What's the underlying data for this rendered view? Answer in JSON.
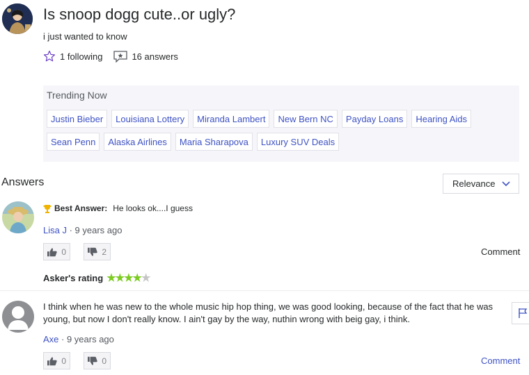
{
  "question": {
    "title": "Is snoop dogg cute..or ugly?",
    "details": "i just wanted to know",
    "following": "1 following",
    "answers_count": "16 answers"
  },
  "trending": {
    "title": "Trending Now",
    "items": [
      "Justin Bieber",
      "Louisiana Lottery",
      "Miranda Lambert",
      "New Bern NC",
      "Payday Loans",
      "Hearing Aids",
      "Sean Penn",
      "Alaska Airlines",
      "Maria Sharapova",
      "Luxury SUV Deals"
    ]
  },
  "answers_header": {
    "title": "Answers",
    "sort_label": "Relevance"
  },
  "answers": [
    {
      "best_label": "Best Answer:",
      "text": "He looks ok....I guess",
      "author": "Lisa J",
      "time": " · 9 years ago",
      "upvotes": "0",
      "downvotes": "2",
      "comment_label": "Comment",
      "rating_label": "Asker's rating",
      "rating_stars": "★★★★",
      "rating_empty": "★",
      "rating": 4,
      "rating_max": 5
    },
    {
      "text": "I think when he was new to the whole music hip hop thing, we was good looking, because of the fact that he was young, but now I don't really know. I ain't gay by the way, nuthin wrong with beig gay, i think.",
      "author": "Axe",
      "time": " · 9 years ago",
      "upvotes": "0",
      "downvotes": "0",
      "comment_label": "Comment"
    }
  ],
  "colors": {
    "link": "#3e52c4",
    "star_filled": "#7dcb22",
    "star_empty": "#c5c5c5",
    "trophy": "#f0b400"
  }
}
